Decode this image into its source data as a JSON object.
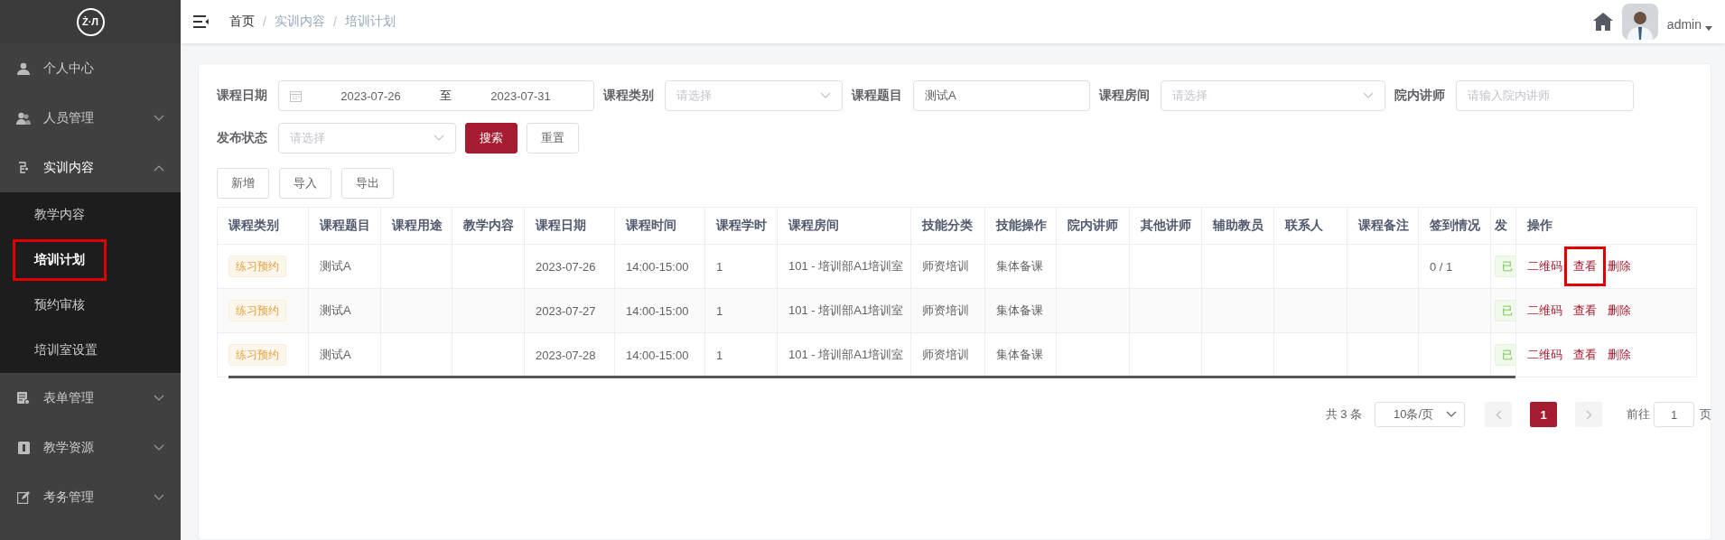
{
  "sidebar": {
    "logo": "Ż·Л",
    "items": [
      {
        "label": "个人中心"
      },
      {
        "label": "人员管理",
        "expanded": false
      },
      {
        "label": "实训内容",
        "expanded": true,
        "children": [
          {
            "label": "教学内容",
            "selected": false,
            "highlighted": false
          },
          {
            "label": "培训计划",
            "selected": true,
            "highlighted": true
          },
          {
            "label": "预约审核",
            "selected": false,
            "highlighted": false
          },
          {
            "label": "培训室设置",
            "selected": false,
            "highlighted": false
          }
        ]
      },
      {
        "label": "表单管理",
        "expanded": false
      },
      {
        "label": "教学资源",
        "expanded": false
      },
      {
        "label": "考务管理",
        "expanded": false
      }
    ]
  },
  "header": {
    "breadcrumb": {
      "separator": "/",
      "items": [
        "首页",
        "实训内容",
        "培训计划"
      ]
    },
    "user": "admin"
  },
  "filters": [
    {
      "kind": "daterange",
      "label": "课程日期",
      "start": "2023-07-26",
      "separator": "至",
      "end": "2023-07-31"
    },
    {
      "kind": "select",
      "label": "课程类别",
      "placeholder": "请选择"
    },
    {
      "kind": "text",
      "label": "课程题目",
      "value": "测试A"
    },
    {
      "kind": "select",
      "label": "课程房间",
      "placeholder": "请选择"
    },
    {
      "kind": "text",
      "label": "院内讲师",
      "placeholder": "请输入院内讲师"
    },
    {
      "kind": "select",
      "label": "发布状态",
      "placeholder": "请选择"
    }
  ],
  "filter_buttons": [
    {
      "label": "搜索",
      "kind": "primary"
    },
    {
      "label": "重置",
      "kind": "plain"
    }
  ],
  "toolbar": [
    "新增",
    "导入",
    "导出"
  ],
  "table": {
    "columns": [
      {
        "label": "课程类别",
        "kind": "category"
      },
      {
        "label": "课程题目"
      },
      {
        "label": "课程用途"
      },
      {
        "label": "教学内容"
      },
      {
        "label": "课程日期"
      },
      {
        "label": "课程时间"
      },
      {
        "label": "课程学时"
      },
      {
        "label": "课程房间"
      },
      {
        "label": "技能分类"
      },
      {
        "label": "技能操作"
      },
      {
        "label": "院内讲师"
      },
      {
        "label": "其他讲师"
      },
      {
        "label": "辅助教员"
      },
      {
        "label": "联系人"
      },
      {
        "label": "课程备注"
      },
      {
        "label": "签到情况"
      },
      {
        "label": "发",
        "kind": "status"
      },
      {
        "label": "操作",
        "kind": "actions"
      }
    ],
    "rows": [
      {
        "cells": [
          "练习预约",
          "测试A",
          null,
          null,
          "2023-07-26",
          "14:00-15:00",
          "1",
          "101 - 培训部A1培训室",
          "师资培训",
          "集体备课",
          null,
          null,
          null,
          null,
          null,
          "0 / 1",
          "已",
          [
            {
              "label": "二维码",
              "highlighted": false
            },
            {
              "label": "查看",
              "highlighted": true
            },
            {
              "label": "删除",
              "highlighted": false
            }
          ]
        ]
      },
      {
        "cells": [
          "练习预约",
          "测试A",
          null,
          null,
          "2023-07-27",
          "14:00-15:00",
          "1",
          "101 - 培训部A1培训室",
          "师资培训",
          "集体备课",
          null,
          null,
          null,
          null,
          null,
          null,
          "已",
          [
            {
              "label": "二维码",
              "highlighted": false
            },
            {
              "label": "查看",
              "highlighted": false
            },
            {
              "label": "删除",
              "highlighted": false
            }
          ]
        ]
      },
      {
        "cells": [
          "练习预约",
          "测试A",
          null,
          null,
          "2023-07-28",
          "14:00-15:00",
          "1",
          "101 - 培训部A1培训室",
          "师资培训",
          "集体备课",
          null,
          null,
          null,
          null,
          null,
          null,
          "已",
          [
            {
              "label": "二维码",
              "highlighted": false
            },
            {
              "label": "查看",
              "highlighted": false
            },
            {
              "label": "删除",
              "highlighted": false
            }
          ]
        ]
      }
    ]
  },
  "pagination": {
    "total": "共 3 条",
    "page_size": "10条/页",
    "pages": [
      {
        "label": "1",
        "selected": true
      }
    ],
    "goto_label": "前往",
    "goto_value": "1",
    "goto_suffix": "页"
  }
}
